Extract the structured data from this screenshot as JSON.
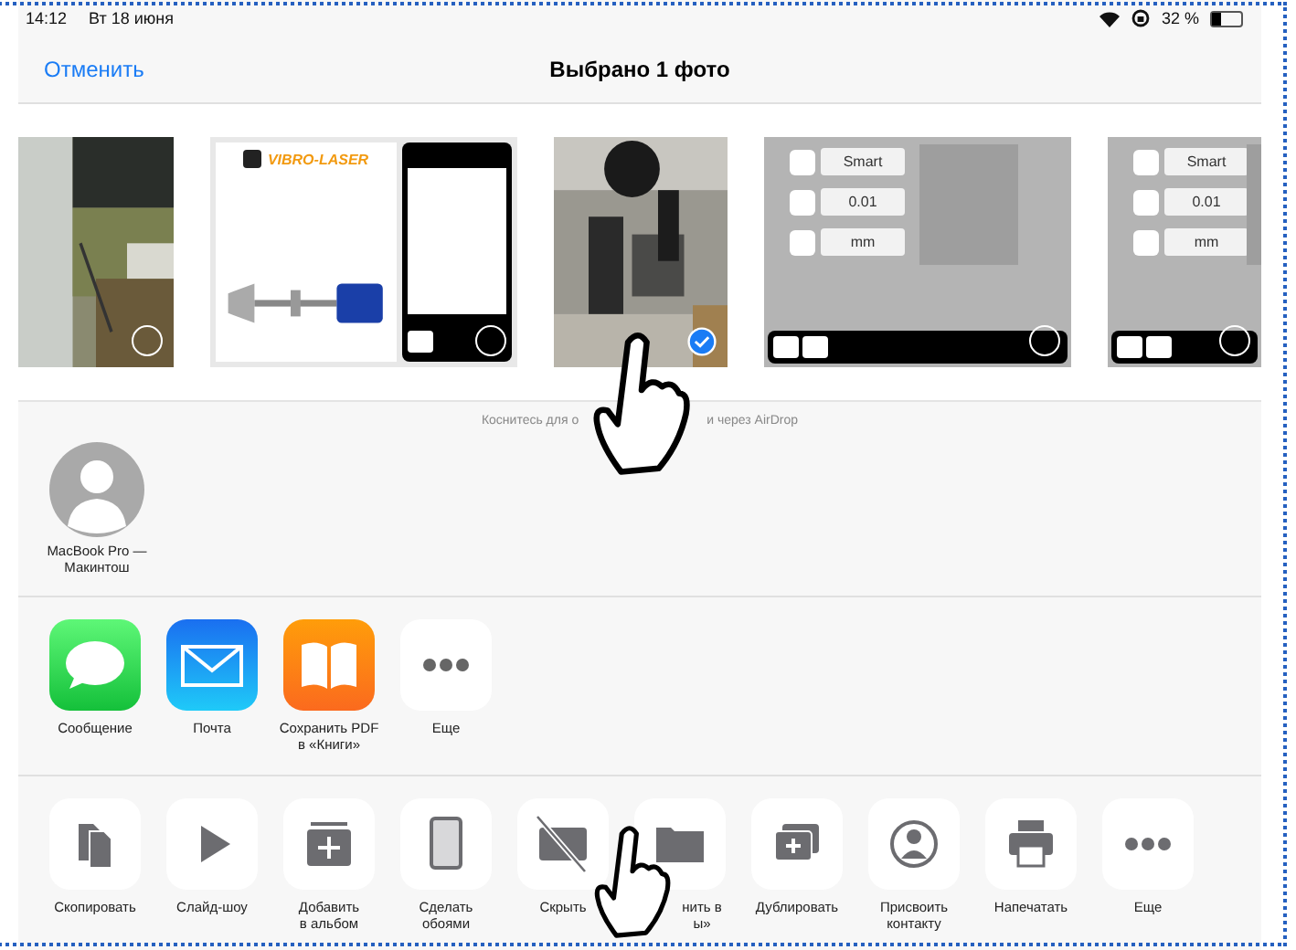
{
  "status_bar": {
    "time": "14:12",
    "date": "Вт 18 июня",
    "battery": "32 %"
  },
  "nav": {
    "cancel": "Отменить",
    "title": "Выбрано 1 фото"
  },
  "photos": [
    {
      "kind": "picture",
      "selected": false
    },
    {
      "kind": "report",
      "logo": "VIBRO-LASER",
      "selected": false
    },
    {
      "kind": "picture",
      "selected": true
    },
    {
      "kind": "settings",
      "fields": [
        "Smart",
        "0.01",
        "mm"
      ],
      "selected": false
    },
    {
      "kind": "settings",
      "fields": [
        "Smart",
        "0.01",
        "mm"
      ],
      "selected": false
    }
  ],
  "airdrop_hint": [
    "Коснитесь для о",
    "и через AirDrop"
  ],
  "airdrop_devices": [
    {
      "name": "MacBook Pro —\nМакинтош"
    }
  ],
  "apps": [
    {
      "kind": "messages",
      "label": "Сообщение"
    },
    {
      "kind": "mail",
      "label": "Почта"
    },
    {
      "kind": "books",
      "label": "Сохранить PDF\nв «Книги»"
    },
    {
      "kind": "more",
      "label": "Еще"
    }
  ],
  "actions": [
    {
      "kind": "copy",
      "label": "Скопировать"
    },
    {
      "kind": "slideshow",
      "label": "Слайд-шоу"
    },
    {
      "kind": "album",
      "label": "Добавить\nв альбом"
    },
    {
      "kind": "wallpaper",
      "label": "Сделать\nобоями"
    },
    {
      "kind": "hide",
      "label": "Скрыть"
    },
    {
      "kind": "files",
      "label": "нить в\nы»"
    },
    {
      "kind": "duplicate",
      "label": "Дублировать"
    },
    {
      "kind": "contact",
      "label": "Присвоить\nконтакту"
    },
    {
      "kind": "print",
      "label": "Напечатать"
    },
    {
      "kind": "more",
      "label": "Еще"
    }
  ]
}
